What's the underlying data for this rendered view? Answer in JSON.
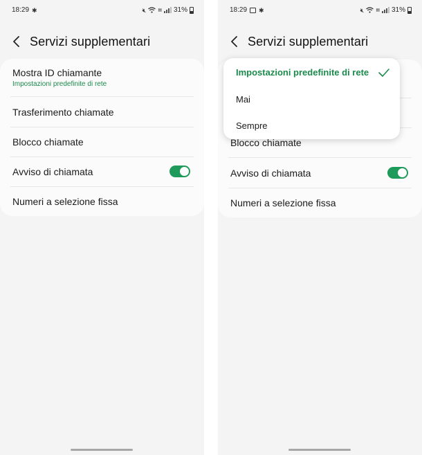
{
  "status": {
    "time": "18:29",
    "battery": "31%"
  },
  "header": {
    "title": "Servizi supplementari"
  },
  "settings": {
    "caller_id_label": "Mostra ID chiamante",
    "caller_id_value": "Impostazioni predefinite di rete",
    "call_forwarding": "Trasferimento chiamate",
    "call_blocking": "Blocco chiamate",
    "call_waiting": "Avviso di chiamata",
    "call_waiting_enabled": true,
    "fixed_dialing": "Numeri a selezione fissa"
  },
  "dropdown": {
    "options": [
      "Impostazioni predefinite di rete",
      "Mai",
      "Sempre"
    ],
    "selected": "Impostazioni predefinite di rete"
  },
  "colors": {
    "accent": "#1e9a5a",
    "background": "#f4f4f4",
    "card": "#fbfbfb"
  },
  "icons": {
    "back": "chevron-left-icon",
    "check": "check-icon",
    "mute": "mute-icon",
    "wifi": "wifi-icon",
    "signal": "signal-icon",
    "battery": "battery-icon"
  }
}
